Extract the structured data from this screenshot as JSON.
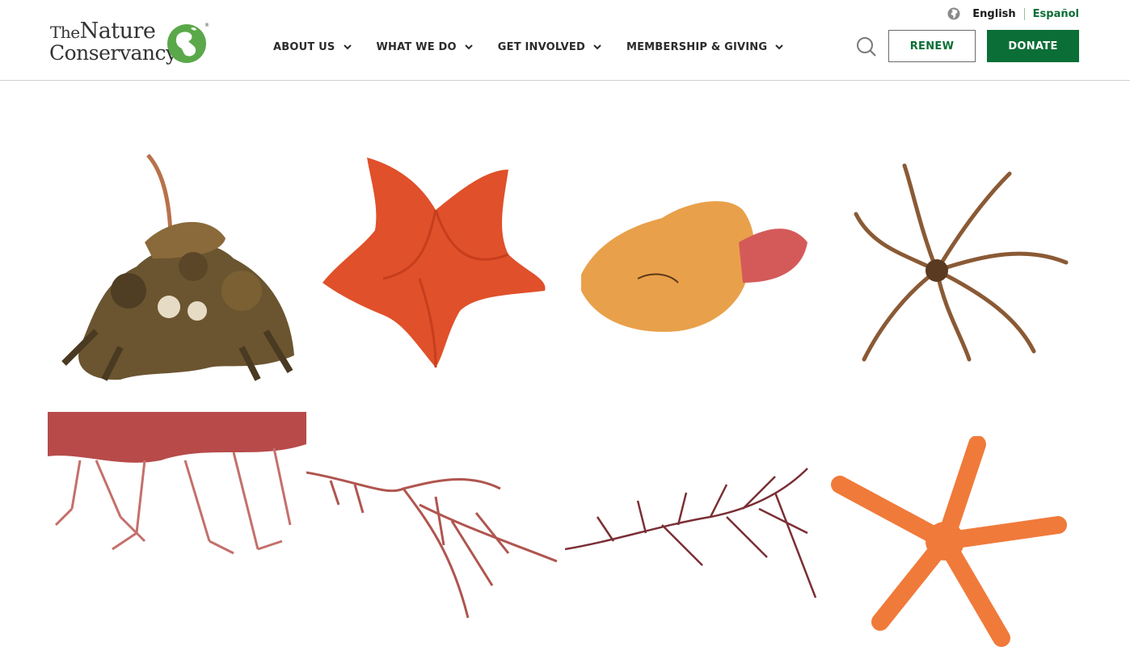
{
  "brand": {
    "name_line1_small": "The",
    "name_line1_large": "Nature",
    "name_line2": "Conservancy",
    "icon": "tnc-leaf-globe-logo",
    "logo_green": "#5aa84a"
  },
  "language": {
    "icon": "globe-icon",
    "current": "English",
    "alternate": "Español"
  },
  "nav": {
    "items": [
      {
        "label": "ABOUT US"
      },
      {
        "label": "WHAT WE DO"
      },
      {
        "label": "GET INVOLVED"
      },
      {
        "label": "MEMBERSHIP & GIVING"
      }
    ]
  },
  "actions": {
    "search_icon": "search-icon",
    "renew_label": "RENEW",
    "donate_label": "DONATE",
    "brand_green": "#0b6e36"
  },
  "gallery": {
    "specimens": [
      {
        "kind": "decorator-crab",
        "color": "#6b5530"
      },
      {
        "kind": "bat-star",
        "color": "#e0502a"
      },
      {
        "kind": "sea-sponge",
        "color": "#e9a04a"
      },
      {
        "kind": "feather-star",
        "color": "#8a5a35"
      },
      {
        "kind": "red-algae",
        "color": "#b84a4a"
      },
      {
        "kind": "red-seaweed-feathery",
        "color": "#b0554f"
      },
      {
        "kind": "red-seaweed-branching",
        "color": "#7a2f35"
      },
      {
        "kind": "sea-star",
        "color": "#f07a3a"
      }
    ]
  }
}
